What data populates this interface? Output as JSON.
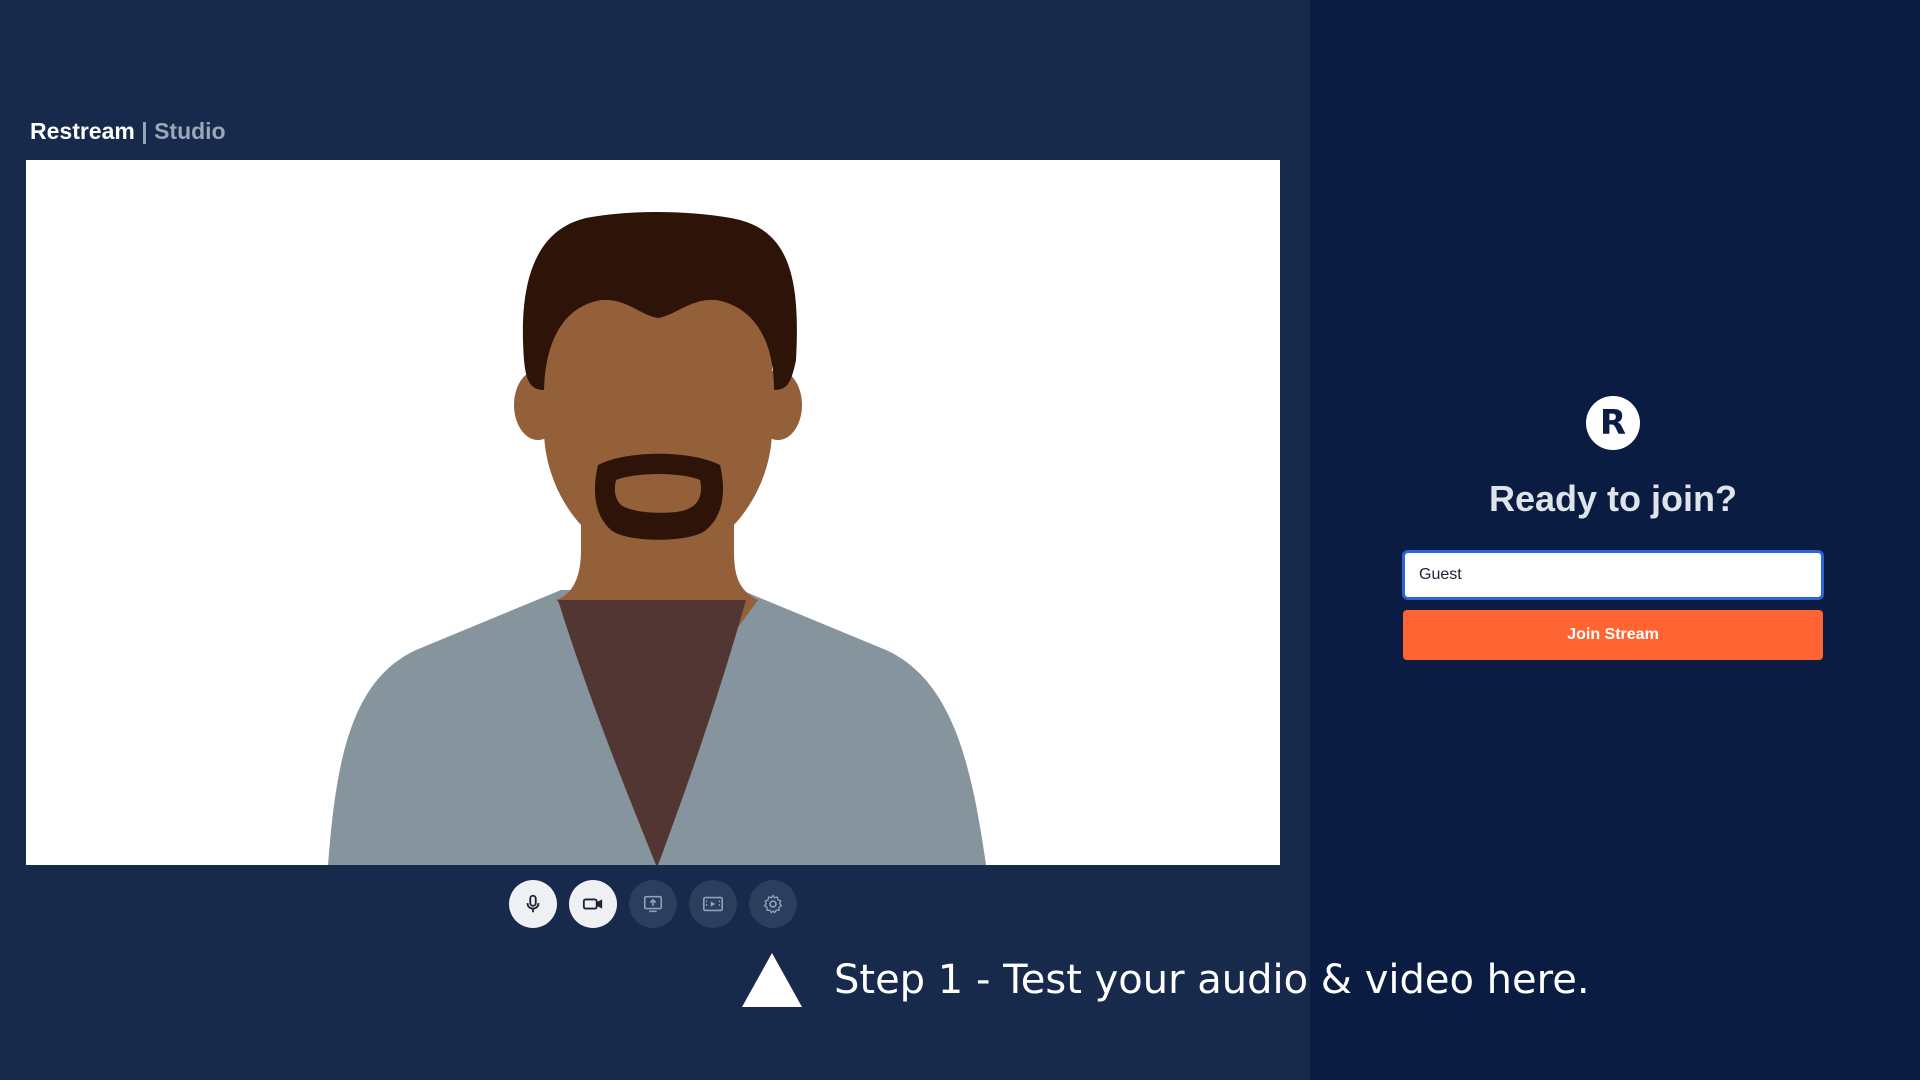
{
  "brand": {
    "name": "Restream",
    "separator": "|",
    "product": "Studio"
  },
  "video": {
    "avatar_icon": "person-avatar-illustration"
  },
  "controls": [
    {
      "name": "microphone",
      "icon": "microphone-icon",
      "state": "on"
    },
    {
      "name": "camera",
      "icon": "camera-icon",
      "state": "on"
    },
    {
      "name": "share-screen",
      "icon": "share-screen-icon",
      "state": "off"
    },
    {
      "name": "share-video",
      "icon": "share-video-icon",
      "state": "off"
    },
    {
      "name": "settings",
      "icon": "gear-icon",
      "state": "off"
    }
  ],
  "join": {
    "logo_letter": "R",
    "title": "Ready to join?",
    "name_value": "Guest",
    "button_label": "Join Stream"
  },
  "hint": {
    "text": "Step 1 - Test your audio & video here."
  },
  "colors": {
    "background": "#172a4b",
    "panel": "#0b1c42",
    "accent": "#ff6533",
    "input_border": "#2c63d8"
  }
}
